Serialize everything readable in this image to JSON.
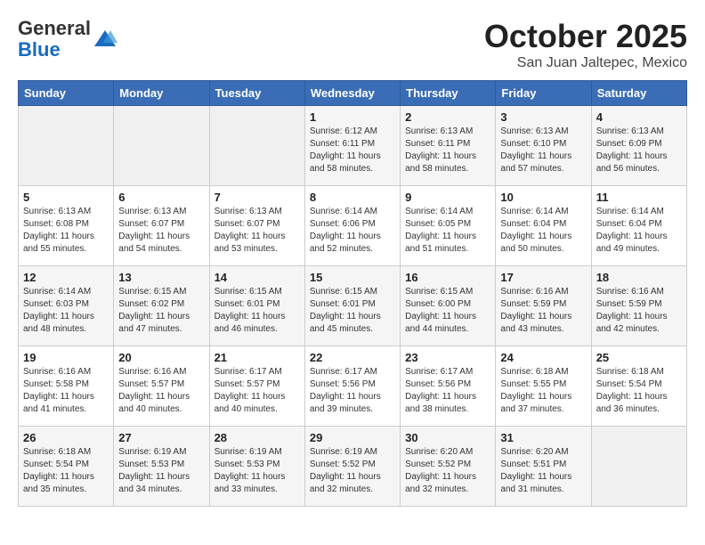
{
  "header": {
    "logo_general": "General",
    "logo_blue": "Blue",
    "month_title": "October 2025",
    "location": "San Juan Jaltepec, Mexico"
  },
  "weekdays": [
    "Sunday",
    "Monday",
    "Tuesday",
    "Wednesday",
    "Thursday",
    "Friday",
    "Saturday"
  ],
  "weeks": [
    [
      {
        "day": "",
        "empty": true
      },
      {
        "day": "",
        "empty": true
      },
      {
        "day": "",
        "empty": true
      },
      {
        "day": "1",
        "sunrise": "6:12 AM",
        "sunset": "6:11 PM",
        "daylight": "11 hours and 58 minutes."
      },
      {
        "day": "2",
        "sunrise": "6:13 AM",
        "sunset": "6:11 PM",
        "daylight": "11 hours and 58 minutes."
      },
      {
        "day": "3",
        "sunrise": "6:13 AM",
        "sunset": "6:10 PM",
        "daylight": "11 hours and 57 minutes."
      },
      {
        "day": "4",
        "sunrise": "6:13 AM",
        "sunset": "6:09 PM",
        "daylight": "11 hours and 56 minutes."
      }
    ],
    [
      {
        "day": "5",
        "sunrise": "6:13 AM",
        "sunset": "6:08 PM",
        "daylight": "11 hours and 55 minutes."
      },
      {
        "day": "6",
        "sunrise": "6:13 AM",
        "sunset": "6:07 PM",
        "daylight": "11 hours and 54 minutes."
      },
      {
        "day": "7",
        "sunrise": "6:13 AM",
        "sunset": "6:07 PM",
        "daylight": "11 hours and 53 minutes."
      },
      {
        "day": "8",
        "sunrise": "6:14 AM",
        "sunset": "6:06 PM",
        "daylight": "11 hours and 52 minutes."
      },
      {
        "day": "9",
        "sunrise": "6:14 AM",
        "sunset": "6:05 PM",
        "daylight": "11 hours and 51 minutes."
      },
      {
        "day": "10",
        "sunrise": "6:14 AM",
        "sunset": "6:04 PM",
        "daylight": "11 hours and 50 minutes."
      },
      {
        "day": "11",
        "sunrise": "6:14 AM",
        "sunset": "6:04 PM",
        "daylight": "11 hours and 49 minutes."
      }
    ],
    [
      {
        "day": "12",
        "sunrise": "6:14 AM",
        "sunset": "6:03 PM",
        "daylight": "11 hours and 48 minutes."
      },
      {
        "day": "13",
        "sunrise": "6:15 AM",
        "sunset": "6:02 PM",
        "daylight": "11 hours and 47 minutes."
      },
      {
        "day": "14",
        "sunrise": "6:15 AM",
        "sunset": "6:01 PM",
        "daylight": "11 hours and 46 minutes."
      },
      {
        "day": "15",
        "sunrise": "6:15 AM",
        "sunset": "6:01 PM",
        "daylight": "11 hours and 45 minutes."
      },
      {
        "day": "16",
        "sunrise": "6:15 AM",
        "sunset": "6:00 PM",
        "daylight": "11 hours and 44 minutes."
      },
      {
        "day": "17",
        "sunrise": "6:16 AM",
        "sunset": "5:59 PM",
        "daylight": "11 hours and 43 minutes."
      },
      {
        "day": "18",
        "sunrise": "6:16 AM",
        "sunset": "5:59 PM",
        "daylight": "11 hours and 42 minutes."
      }
    ],
    [
      {
        "day": "19",
        "sunrise": "6:16 AM",
        "sunset": "5:58 PM",
        "daylight": "11 hours and 41 minutes."
      },
      {
        "day": "20",
        "sunrise": "6:16 AM",
        "sunset": "5:57 PM",
        "daylight": "11 hours and 40 minutes."
      },
      {
        "day": "21",
        "sunrise": "6:17 AM",
        "sunset": "5:57 PM",
        "daylight": "11 hours and 40 minutes."
      },
      {
        "day": "22",
        "sunrise": "6:17 AM",
        "sunset": "5:56 PM",
        "daylight": "11 hours and 39 minutes."
      },
      {
        "day": "23",
        "sunrise": "6:17 AM",
        "sunset": "5:56 PM",
        "daylight": "11 hours and 38 minutes."
      },
      {
        "day": "24",
        "sunrise": "6:18 AM",
        "sunset": "5:55 PM",
        "daylight": "11 hours and 37 minutes."
      },
      {
        "day": "25",
        "sunrise": "6:18 AM",
        "sunset": "5:54 PM",
        "daylight": "11 hours and 36 minutes."
      }
    ],
    [
      {
        "day": "26",
        "sunrise": "6:18 AM",
        "sunset": "5:54 PM",
        "daylight": "11 hours and 35 minutes."
      },
      {
        "day": "27",
        "sunrise": "6:19 AM",
        "sunset": "5:53 PM",
        "daylight": "11 hours and 34 minutes."
      },
      {
        "day": "28",
        "sunrise": "6:19 AM",
        "sunset": "5:53 PM",
        "daylight": "11 hours and 33 minutes."
      },
      {
        "day": "29",
        "sunrise": "6:19 AM",
        "sunset": "5:52 PM",
        "daylight": "11 hours and 32 minutes."
      },
      {
        "day": "30",
        "sunrise": "6:20 AM",
        "sunset": "5:52 PM",
        "daylight": "11 hours and 32 minutes."
      },
      {
        "day": "31",
        "sunrise": "6:20 AM",
        "sunset": "5:51 PM",
        "daylight": "11 hours and 31 minutes."
      },
      {
        "day": "",
        "empty": true
      }
    ]
  ]
}
